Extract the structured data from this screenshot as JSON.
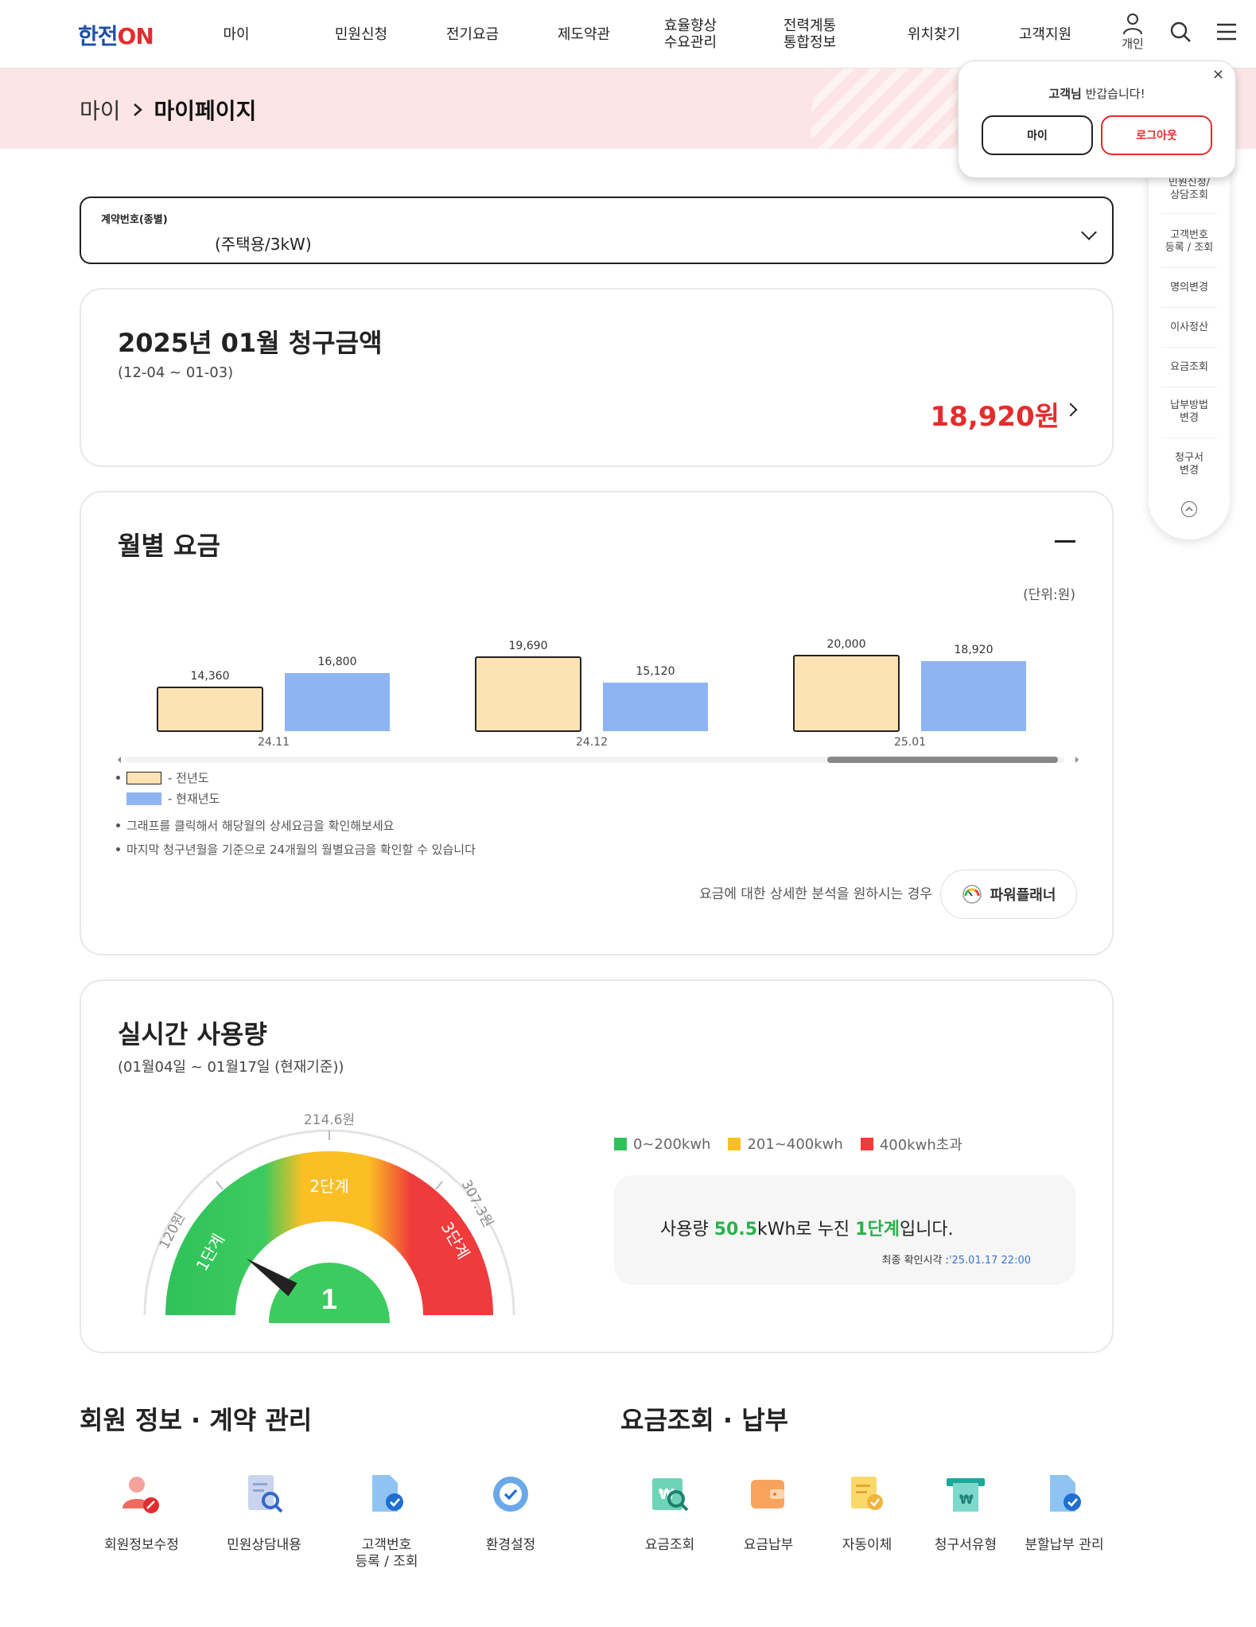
{
  "header": {
    "logo_han": "한전",
    "logo_on": "ON",
    "nav": [
      "마이",
      "민원신청",
      "전기요금",
      "제도약관",
      "효율향상\n수요관리",
      "전력계통\n통합정보",
      "위치찾기",
      "고객지원"
    ],
    "person_label": "개인"
  },
  "breadcrumb": {
    "parent": "마이",
    "current": "마이페이지"
  },
  "popup": {
    "greet_name": "고객님",
    "greet_rest": " 반갑습니다!",
    "my_button": "마이",
    "logout_button": "로그아웃",
    "close": "×"
  },
  "quick_menu": [
    "민원신청/\n상담조회",
    "고객번호\n등록 / 조회",
    "명의변경",
    "이사정산",
    "요금조회",
    "납부방법\n변경",
    "청구서\n변경"
  ],
  "contract": {
    "label": "계약번호(종별)",
    "value": "(주택용/3kW)"
  },
  "bill": {
    "title": "2025년 01월 청구금액",
    "period": "(12-04 ~ 01-03)",
    "amount": "18,920원"
  },
  "monthly": {
    "title": "월별 요금",
    "unit": "(단위:원)",
    "legend_prev": "- 전년도",
    "legend_cur": "- 현재년도",
    "note1": "그래프를 클릭해서 해당월의 상세요금을 확인해보세요",
    "note2": "마지막 청구년월을 기준으로 24개월의 월별요금을 확인할 수 있습니다",
    "planner_text": "요금에 대한 상세한 분석을 원하시는 경우",
    "planner_button": "파워플래너"
  },
  "chart_data": {
    "type": "bar",
    "categories": [
      "24.11",
      "24.12",
      "25.01"
    ],
    "series": [
      {
        "name": "전년도",
        "values": [
          14360,
          19690,
          20000
        ],
        "labels": [
          "14,360",
          "19,690",
          "20,000"
        ]
      },
      {
        "name": "현재년도",
        "values": [
          16800,
          15120,
          18920
        ],
        "labels": [
          "16,800",
          "15,120",
          "18,920"
        ]
      }
    ],
    "ylim": [
      0,
      22000
    ],
    "colors": {
      "prev": "#fde3b4",
      "cur": "#8fb4f4"
    }
  },
  "realtime": {
    "title": "실시간 사용량",
    "period": "(01월04일 ~ 01월17일 (현재기준))",
    "gauge": {
      "tier1": "1단계",
      "tier2": "2단계",
      "tier3": "3단계",
      "mark1": "120원",
      "mark2": "214.6원",
      "mark3": "307.3원",
      "current_tier": "1",
      "level": 0.1
    },
    "legend": [
      {
        "label": "0~200kwh",
        "color": "#2fc25b"
      },
      {
        "label": "201~400kwh",
        "color": "#fbbf24"
      },
      {
        "label": "400kwh초과",
        "color": "#ef3b3b"
      }
    ],
    "msg_pre": "사용량 ",
    "msg_value": "50.5",
    "msg_mid": "kWh로 누진 ",
    "msg_tier": "1단계",
    "msg_post": "입니다.",
    "time_label": "최종 확인시각 :",
    "time_value": "'25.01.17 22:00"
  },
  "member": {
    "title": "회원 정보 · 계약 관리",
    "items": [
      "회원정보수정",
      "민원상담내용",
      "고객번호\n등록 / 조회",
      "환경설정"
    ]
  },
  "billing": {
    "title": "요금조회 · 납부",
    "items": [
      "요금조회",
      "요금납부",
      "자동이체",
      "청구서유형",
      "분할납부 관리"
    ]
  }
}
